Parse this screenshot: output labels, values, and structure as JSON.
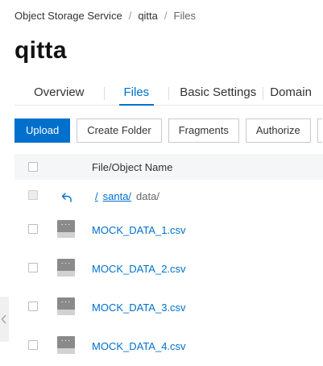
{
  "breadcrumb": {
    "items": [
      "Object Storage Service",
      "qitta",
      "Files"
    ],
    "separator": "/"
  },
  "page": {
    "title": "qitta"
  },
  "tabs": [
    {
      "label": "Overview",
      "active": false
    },
    {
      "label": "Files",
      "active": true
    },
    {
      "label": "Basic Settings",
      "active": false
    },
    {
      "label": "Domain",
      "active": false
    }
  ],
  "toolbar": {
    "upload": "Upload",
    "create_folder": "Create Folder",
    "fragments": "Fragments",
    "authorize": "Authorize"
  },
  "table": {
    "column_name": "File/Object Name",
    "path": {
      "root": "/",
      "folder": "santa/",
      "current": "data/"
    },
    "files": [
      {
        "name": "MOCK_DATA_1.csv",
        "icon": "file-icon"
      },
      {
        "name": "MOCK_DATA_2.csv",
        "icon": "file-icon"
      },
      {
        "name": "MOCK_DATA_3.csv",
        "icon": "file-icon"
      },
      {
        "name": "MOCK_DATA_4.csv",
        "icon": "file-icon"
      }
    ]
  },
  "colors": {
    "accent": "#0070cc",
    "header_bg": "#f5f6f7",
    "file_icon": "#8a8a8a"
  }
}
